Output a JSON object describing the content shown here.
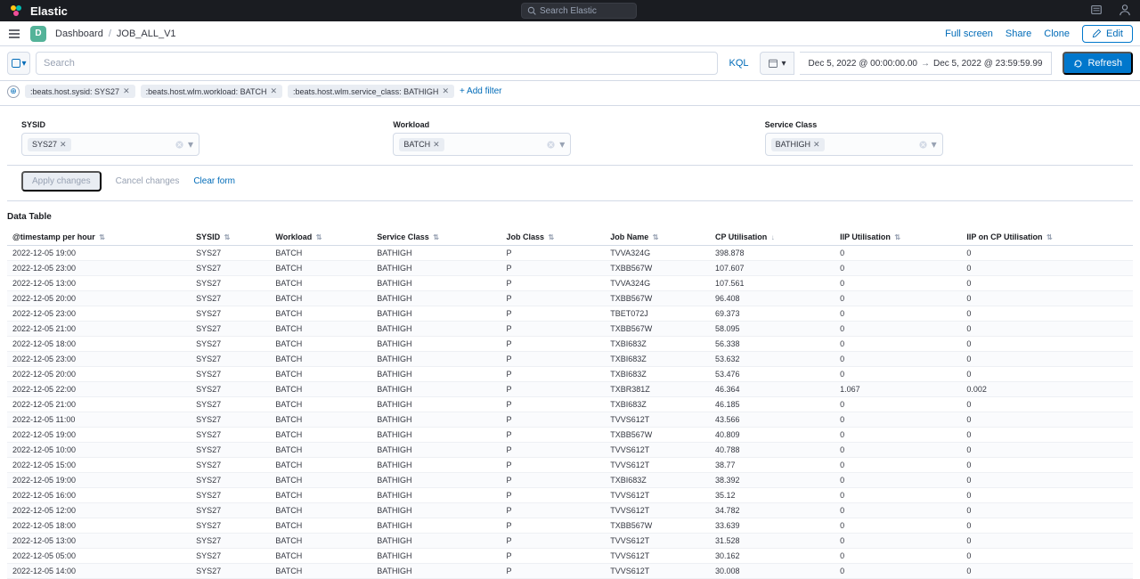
{
  "header": {
    "brand": "Elastic",
    "search_placeholder": "Search Elastic"
  },
  "nav": {
    "space": "D",
    "breadcrumb": [
      "Dashboard",
      "JOB_ALL_V1"
    ],
    "actions": {
      "fullscreen": "Full screen",
      "share": "Share",
      "clone": "Clone",
      "edit": "Edit"
    }
  },
  "query": {
    "search_placeholder": "Search",
    "kql": "KQL",
    "date_from": "Dec 5, 2022 @ 00:00:00.00",
    "date_to": "Dec 5, 2022 @ 23:59:59.99",
    "refresh": "Refresh"
  },
  "filters": {
    "pills": [
      ":beats.host.sysid: SYS27",
      ":beats.host.wlm.workload: BATCH",
      ":beats.host.wlm.service_class: BATHIGH"
    ],
    "add": "+ Add filter"
  },
  "controls": {
    "groups": [
      {
        "label": "SYSID",
        "value": "SYS27"
      },
      {
        "label": "Workload",
        "value": "BATCH"
      },
      {
        "label": "Service Class",
        "value": "BATHIGH"
      }
    ],
    "apply": "Apply changes",
    "cancel": "Cancel changes",
    "clear": "Clear form"
  },
  "table": {
    "title": "Data Table",
    "columns": [
      "@timestamp per hour",
      "SYSID",
      "Workload",
      "Service Class",
      "Job Class",
      "Job Name",
      "CP Utilisation",
      "IIP Utilisation",
      "IIP on CP Utilisation"
    ],
    "sort_col": 6,
    "sort_dir": "desc",
    "rows": [
      [
        "2022-12-05 19:00",
        "SYS27",
        "BATCH",
        "BATHIGH",
        "P",
        "TVVA324G",
        "398.878",
        "0",
        "0"
      ],
      [
        "2022-12-05 23:00",
        "SYS27",
        "BATCH",
        "BATHIGH",
        "P",
        "TXBB567W",
        "107.607",
        "0",
        "0"
      ],
      [
        "2022-12-05 13:00",
        "SYS27",
        "BATCH",
        "BATHIGH",
        "P",
        "TVVA324G",
        "107.561",
        "0",
        "0"
      ],
      [
        "2022-12-05 20:00",
        "SYS27",
        "BATCH",
        "BATHIGH",
        "P",
        "TXBB567W",
        "96.408",
        "0",
        "0"
      ],
      [
        "2022-12-05 23:00",
        "SYS27",
        "BATCH",
        "BATHIGH",
        "P",
        "TBET072J",
        "69.373",
        "0",
        "0"
      ],
      [
        "2022-12-05 21:00",
        "SYS27",
        "BATCH",
        "BATHIGH",
        "P",
        "TXBB567W",
        "58.095",
        "0",
        "0"
      ],
      [
        "2022-12-05 18:00",
        "SYS27",
        "BATCH",
        "BATHIGH",
        "P",
        "TXBI683Z",
        "56.338",
        "0",
        "0"
      ],
      [
        "2022-12-05 23:00",
        "SYS27",
        "BATCH",
        "BATHIGH",
        "P",
        "TXBI683Z",
        "53.632",
        "0",
        "0"
      ],
      [
        "2022-12-05 20:00",
        "SYS27",
        "BATCH",
        "BATHIGH",
        "P",
        "TXBI683Z",
        "53.476",
        "0",
        "0"
      ],
      [
        "2022-12-05 22:00",
        "SYS27",
        "BATCH",
        "BATHIGH",
        "P",
        "TXBR381Z",
        "46.364",
        "1.067",
        "0.002"
      ],
      [
        "2022-12-05 21:00",
        "SYS27",
        "BATCH",
        "BATHIGH",
        "P",
        "TXBI683Z",
        "46.185",
        "0",
        "0"
      ],
      [
        "2022-12-05 11:00",
        "SYS27",
        "BATCH",
        "BATHIGH",
        "P",
        "TVVS612T",
        "43.566",
        "0",
        "0"
      ],
      [
        "2022-12-05 19:00",
        "SYS27",
        "BATCH",
        "BATHIGH",
        "P",
        "TXBB567W",
        "40.809",
        "0",
        "0"
      ],
      [
        "2022-12-05 10:00",
        "SYS27",
        "BATCH",
        "BATHIGH",
        "P",
        "TVVS612T",
        "40.788",
        "0",
        "0"
      ],
      [
        "2022-12-05 15:00",
        "SYS27",
        "BATCH",
        "BATHIGH",
        "P",
        "TVVS612T",
        "38.77",
        "0",
        "0"
      ],
      [
        "2022-12-05 19:00",
        "SYS27",
        "BATCH",
        "BATHIGH",
        "P",
        "TXBI683Z",
        "38.392",
        "0",
        "0"
      ],
      [
        "2022-12-05 16:00",
        "SYS27",
        "BATCH",
        "BATHIGH",
        "P",
        "TVVS612T",
        "35.12",
        "0",
        "0"
      ],
      [
        "2022-12-05 12:00",
        "SYS27",
        "BATCH",
        "BATHIGH",
        "P",
        "TVVS612T",
        "34.782",
        "0",
        "0"
      ],
      [
        "2022-12-05 18:00",
        "SYS27",
        "BATCH",
        "BATHIGH",
        "P",
        "TXBB567W",
        "33.639",
        "0",
        "0"
      ],
      [
        "2022-12-05 13:00",
        "SYS27",
        "BATCH",
        "BATHIGH",
        "P",
        "TVVS612T",
        "31.528",
        "0",
        "0"
      ],
      [
        "2022-12-05 05:00",
        "SYS27",
        "BATCH",
        "BATHIGH",
        "P",
        "TVVS612T",
        "30.162",
        "0",
        "0"
      ],
      [
        "2022-12-05 14:00",
        "SYS27",
        "BATCH",
        "BATHIGH",
        "P",
        "TVVS612T",
        "30.008",
        "0",
        "0"
      ]
    ]
  }
}
